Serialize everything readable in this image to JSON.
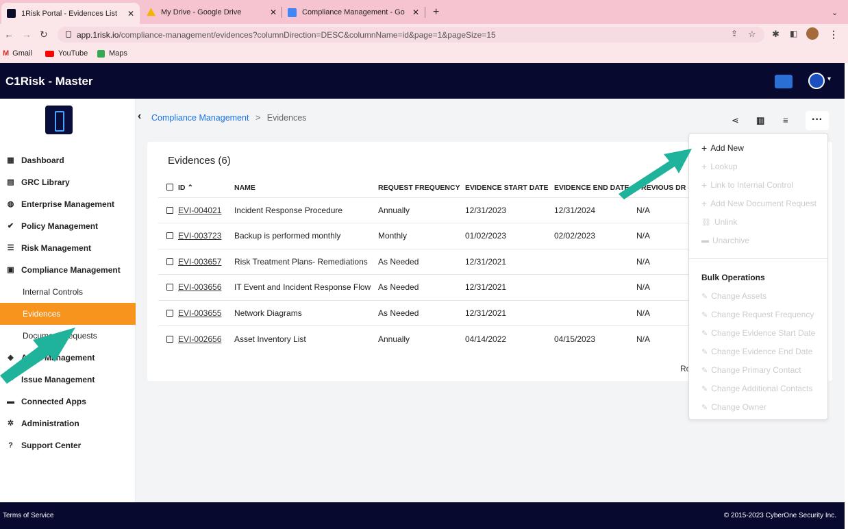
{
  "browser": {
    "tabs": [
      {
        "title": "1Risk Portal - Evidences List",
        "favicon_color": "#0b0b2a"
      },
      {
        "title": "My Drive - Google Drive",
        "favicon_color": "#f4b400"
      },
      {
        "title": "Compliance Management - Go",
        "favicon_color": "#4285f4"
      }
    ],
    "url_host": "app.1risk.io",
    "url_path": "/compliance-management/evidences?columnDirection=DESC&columnName=id&page=1&pageSize=15",
    "bookmarks": [
      "Gmail",
      "YouTube",
      "Maps"
    ]
  },
  "app": {
    "title": "C1Risk - Master"
  },
  "sidebar": {
    "items": [
      {
        "label": "Dashboard",
        "icon": "dashboard-icon"
      },
      {
        "label": "GRC Library",
        "icon": "book-icon"
      },
      {
        "label": "Enterprise Management",
        "icon": "globe-icon"
      },
      {
        "label": "Policy Management",
        "icon": "check-icon"
      },
      {
        "label": "Risk Management",
        "icon": "list-icon"
      },
      {
        "label": "Compliance Management",
        "icon": "clipboard-icon"
      }
    ],
    "sub_items": [
      "Internal Controls",
      "Evidences",
      "Document Requests"
    ],
    "items_after": [
      {
        "label": "Audit Management",
        "icon": "audit-icon"
      },
      {
        "label": "Issue Management",
        "icon": "flag-icon"
      },
      {
        "label": "Connected Apps",
        "icon": "app-icon"
      },
      {
        "label": "Administration",
        "icon": "cog-icon"
      },
      {
        "label": "Support Center",
        "icon": "help-icon"
      }
    ]
  },
  "breadcrumb": {
    "parent": "Compliance Management",
    "separator": ">",
    "current": "Evidences"
  },
  "card": {
    "title": "Evidences (6)",
    "columns": [
      "ID",
      "NAME",
      "REQUEST FREQUENCY",
      "EVIDENCE START DATE",
      "EVIDENCE END DATE",
      "PREVIOUS DR ST"
    ],
    "rows": [
      {
        "id": "EVI-004021",
        "name": "Incident Response Procedure",
        "freq": "Annually",
        "start": "12/31/2023",
        "end": "12/31/2024",
        "prev": "N/A"
      },
      {
        "id": "EVI-003723",
        "name": "Backup is performed monthly",
        "freq": "Monthly",
        "start": "01/02/2023",
        "end": "02/02/2023",
        "prev": "N/A"
      },
      {
        "id": "EVI-003657",
        "name": "Risk Treatment Plans- Remediations",
        "freq": "As Needed",
        "start": "12/31/2021",
        "end": "",
        "prev": "N/A"
      },
      {
        "id": "EVI-003656",
        "name": "IT Event and Incident Response Flow",
        "freq": "As Needed",
        "start": "12/31/2021",
        "end": "",
        "prev": "N/A"
      },
      {
        "id": "EVI-003655",
        "name": "Network Diagrams",
        "freq": "As Needed",
        "start": "12/31/2021",
        "end": "",
        "prev": "N/A"
      },
      {
        "id": "EVI-002656",
        "name": "Asset Inventory List",
        "freq": "Annually",
        "start": "04/14/2022",
        "end": "04/15/2023",
        "prev": "N/A"
      }
    ],
    "rows_label": "Ro"
  },
  "menu": {
    "actions": [
      {
        "label": "Add New",
        "enabled": true
      },
      {
        "label": "Lookup",
        "enabled": false
      },
      {
        "label": "Link to Internal Control",
        "enabled": false
      },
      {
        "label": "Add New Document Request",
        "enabled": false
      },
      {
        "label": "Unlink",
        "enabled": false
      },
      {
        "label": "Unarchive",
        "enabled": false
      }
    ],
    "bulk_title": "Bulk Operations",
    "bulk": [
      "Change Assets",
      "Change Request Frequency",
      "Change Evidence Start Date",
      "Change Evidence End Date",
      "Change Primary Contact",
      "Change Additional Contacts",
      "Change Owner"
    ]
  },
  "footer": {
    "left": "Terms of Service",
    "right": "© 2015-2023 CyberOne Security Inc."
  },
  "colors": {
    "accent": "#f7941d",
    "header": "#070a2e",
    "link": "#1a73e8",
    "arrow": "#1fb39b"
  }
}
